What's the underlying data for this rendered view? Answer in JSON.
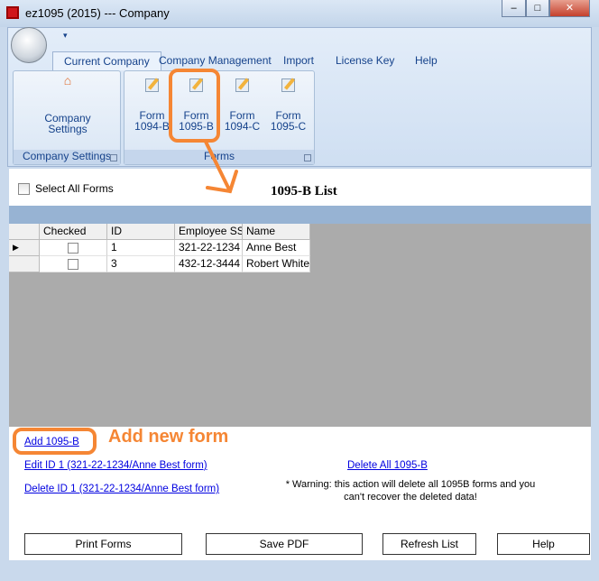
{
  "window": {
    "title": "ez1095 (2015) --- Company",
    "minimize": "‒",
    "maximize": "□",
    "close": "✕"
  },
  "ribbon": {
    "tabs": [
      {
        "label": "Current Company",
        "active": true
      },
      {
        "label": "Company Management"
      },
      {
        "label": "Import"
      },
      {
        "label": "License Key"
      },
      {
        "label": "Help"
      }
    ],
    "groups": [
      {
        "label": "Company Settings",
        "buttons": [
          {
            "line1": "Company",
            "line2": "Settings",
            "icon": "home-icon"
          }
        ]
      },
      {
        "label": "Forms",
        "buttons": [
          {
            "line1": "Form",
            "line2": "1094-B",
            "icon": "form-edit-icon"
          },
          {
            "line1": "Form",
            "line2": "1095-B",
            "icon": "form-edit-icon"
          },
          {
            "line1": "Form",
            "line2": "1094-C",
            "icon": "form-edit-icon"
          },
          {
            "line1": "Form",
            "line2": "1095-C",
            "icon": "form-edit-icon"
          }
        ]
      }
    ]
  },
  "list": {
    "select_all_label": "Select All Forms",
    "title": "1095-B List",
    "columns": [
      "Checked",
      "ID",
      "Employee SS",
      "Name"
    ],
    "rows": [
      {
        "checked": false,
        "id": "1",
        "ss": "321-22-1234",
        "name": "Anne Best",
        "current": true
      },
      {
        "checked": false,
        "id": "3",
        "ss": "432-12-3444",
        "name": "Robert White"
      }
    ]
  },
  "actions": {
    "add": "Add 1095-B",
    "edit": "Edit ID 1 (321-22-1234/Anne Best form)",
    "delete": "Delete ID 1 (321-22-1234/Anne Best form)",
    "delete_all": "Delete All 1095-B",
    "warning_line1": "* Warning: this action will delete all 1095B forms and you",
    "warning_line2": "can't recover the deleted data!"
  },
  "buttons": {
    "print": "Print Forms",
    "save_pdf": "Save PDF",
    "refresh": "Refresh List",
    "help": "Help"
  },
  "annotation": {
    "text": "Add new form",
    "color": "#f58634"
  }
}
